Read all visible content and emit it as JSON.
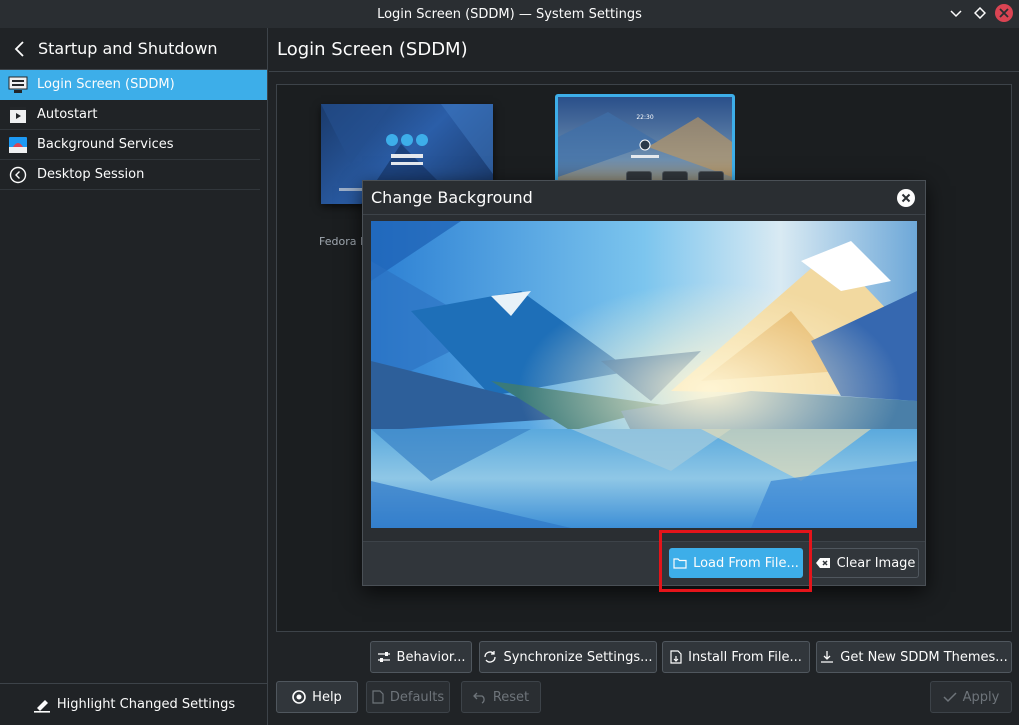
{
  "window": {
    "title": "Login Screen (SDDM) — System Settings",
    "controls": [
      "chevron-down-icon",
      "diamond-icon",
      "close-icon"
    ]
  },
  "sidebar": {
    "header": "Startup and Shutdown",
    "items": [
      {
        "label": "Login Screen (SDDM)",
        "icon": "login-screen-icon",
        "active": true
      },
      {
        "label": "Autostart",
        "icon": "autostart-icon",
        "active": false
      },
      {
        "label": "Background Services",
        "icon": "background-services-icon",
        "active": false
      },
      {
        "label": "Desktop Session",
        "icon": "desktop-session-icon",
        "active": false
      }
    ],
    "footer": "Highlight Changed Settings"
  },
  "main": {
    "title": "Login Screen (SDDM)",
    "theme_label_partial": "Fedora K"
  },
  "dialog": {
    "title": "Change Background",
    "load_button": "Load From File...",
    "clear_button": "Clear Image"
  },
  "toolbar": {
    "behavior": "Behavior...",
    "sync": "Synchronize Settings...",
    "install": "Install From File...",
    "get_new": "Get New SDDM Themes..."
  },
  "bottom": {
    "help": "Help",
    "defaults": "Defaults",
    "reset": "Reset",
    "apply": "Apply"
  },
  "colors": {
    "accent": "#3daee9",
    "highlight": "#e5141a",
    "window_bg": "#202326"
  }
}
